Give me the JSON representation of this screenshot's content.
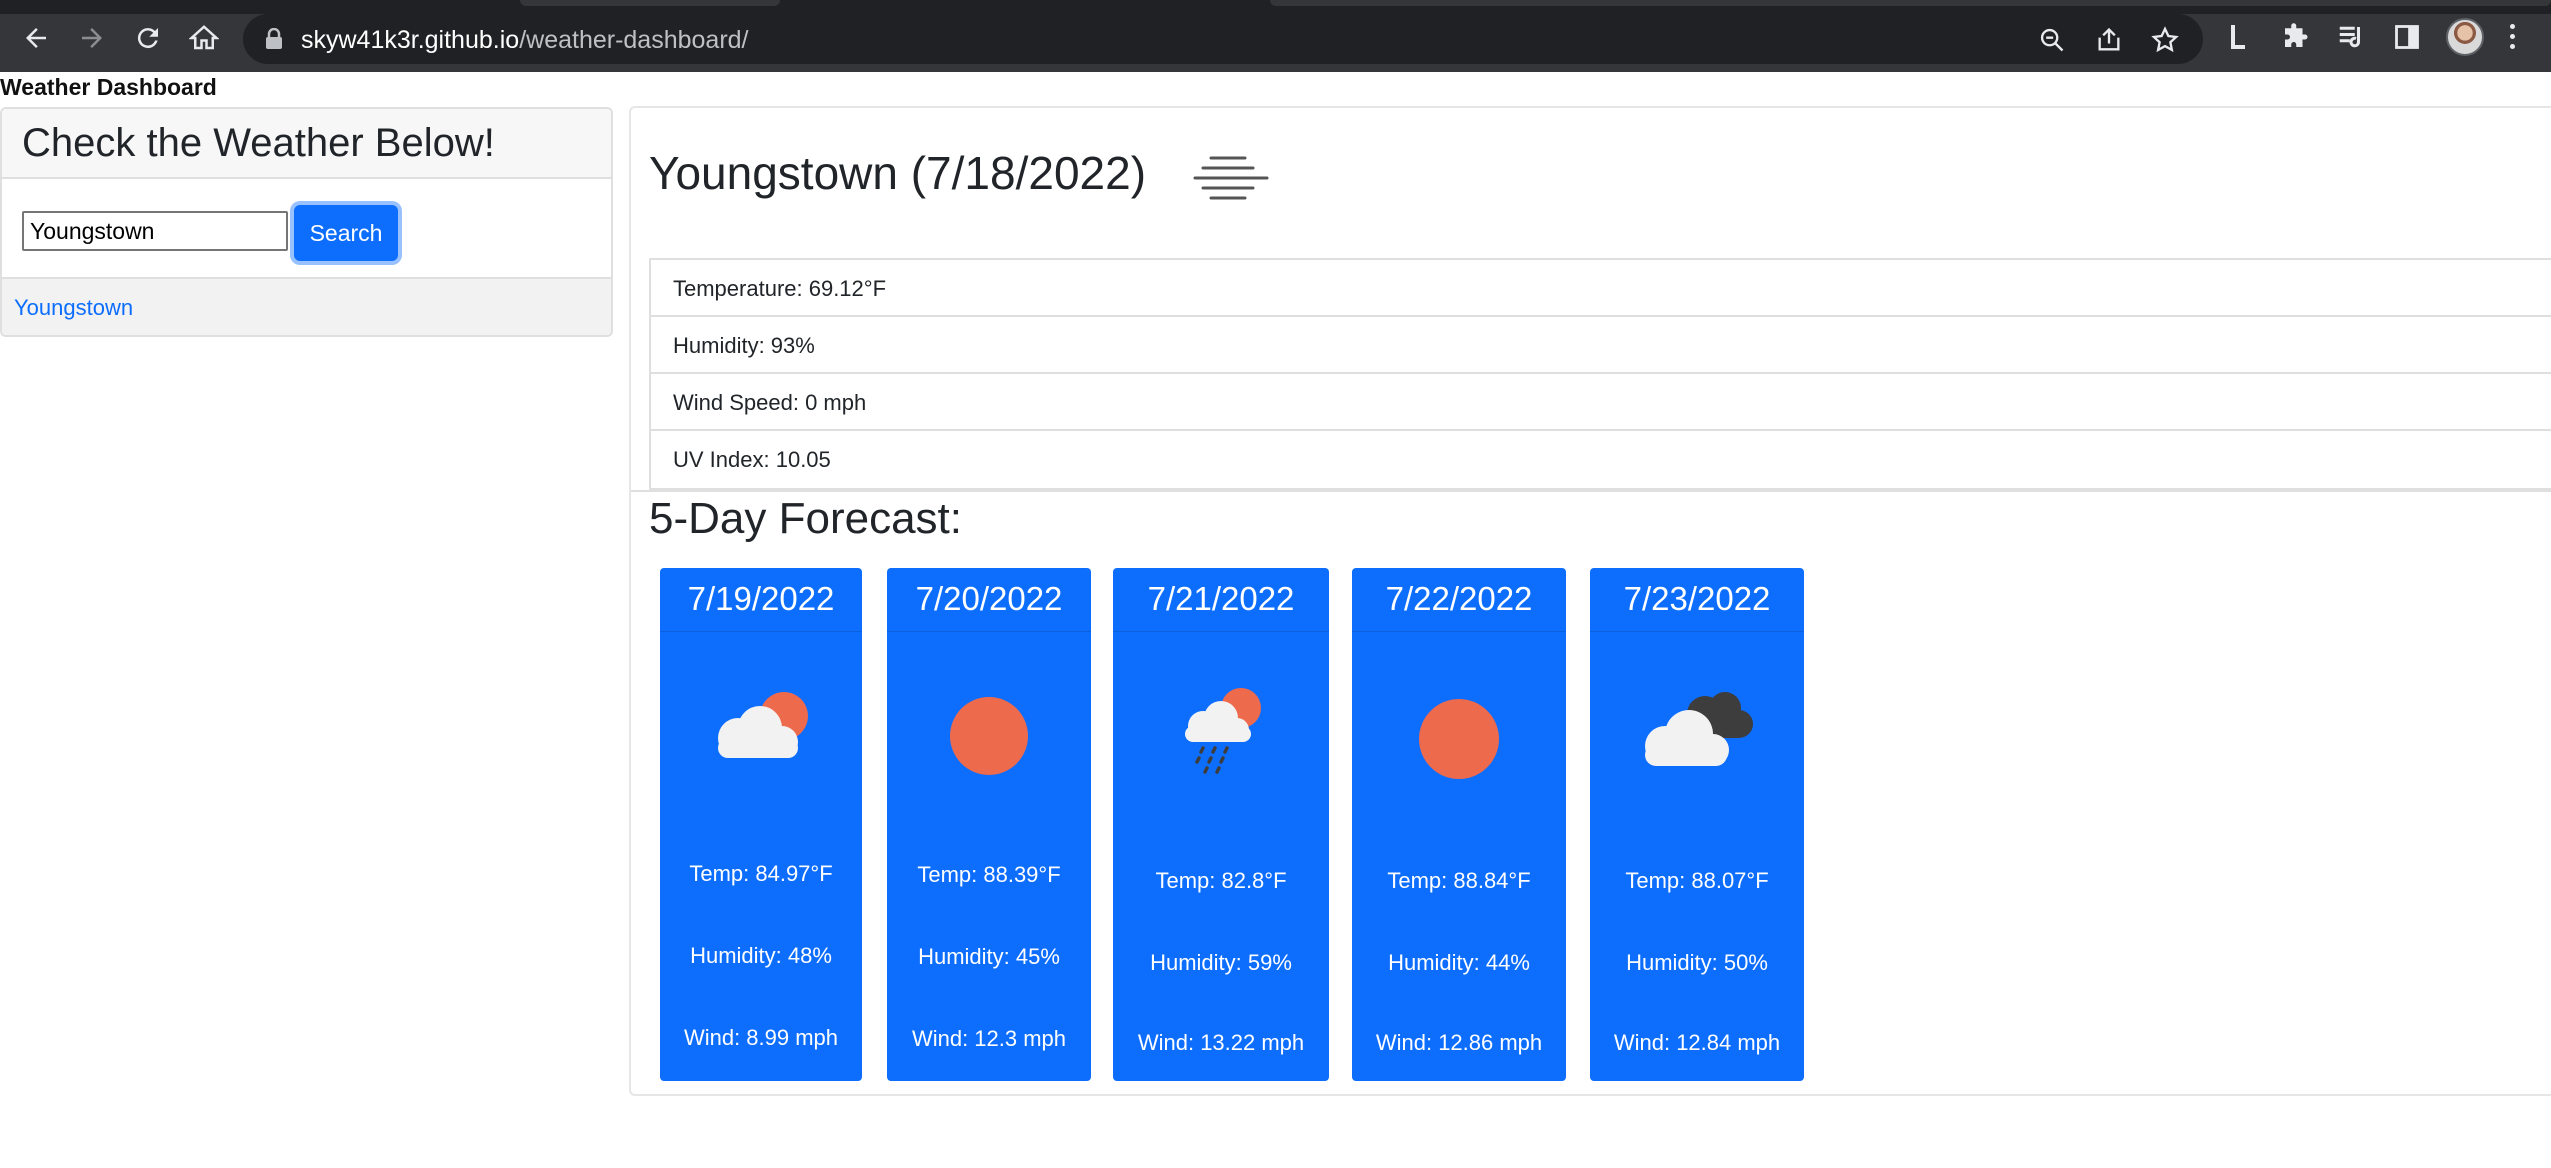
{
  "browser": {
    "url_host": "skyw41k3r.github.io",
    "url_path": "/weather-dashboard/"
  },
  "app": {
    "brand": "Weather Dashboard"
  },
  "sidebar": {
    "heading": "Check the Weather Below!",
    "search_value": "Youngstown",
    "search_button": "Search",
    "history": [
      "Youngstown"
    ]
  },
  "current": {
    "title": "Youngstown (7/18/2022)",
    "icon": "mist-icon",
    "temperature": "Temperature: 69.12°F",
    "humidity": "Humidity: 93%",
    "wind": "Wind Speed: 0 mph",
    "uv": "UV Index: 10.05"
  },
  "forecast": {
    "title": "5-Day Forecast:",
    "days": [
      {
        "date": "7/19/2022",
        "icon": "partly-cloudy-icon",
        "temp": "Temp: 84.97°F",
        "humidity": "Humidity: 48%",
        "wind": "Wind: 8.99 mph"
      },
      {
        "date": "7/20/2022",
        "icon": "sun-icon",
        "temp": "Temp: 88.39°F",
        "humidity": "Humidity: 45%",
        "wind": "Wind: 12.3 mph"
      },
      {
        "date": "7/21/2022",
        "icon": "rain-sun-icon",
        "temp": "Temp: 82.8°F",
        "humidity": "Humidity: 59%",
        "wind": "Wind: 13.22 mph"
      },
      {
        "date": "7/22/2022",
        "icon": "sun-icon",
        "temp": "Temp: 88.84°F",
        "humidity": "Humidity: 44%",
        "wind": "Wind: 12.86 mph"
      },
      {
        "date": "7/23/2022",
        "icon": "broken-clouds-icon",
        "temp": "Temp: 88.07°F",
        "humidity": "Humidity: 50%",
        "wind": "Wind: 12.84 mph"
      }
    ]
  },
  "colors": {
    "accent": "#0d6efd",
    "sun": "#ed6a4d",
    "cloud": "#f2f2f2",
    "dark_cloud": "#3d3d3d"
  }
}
